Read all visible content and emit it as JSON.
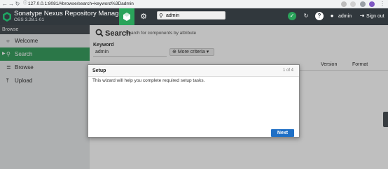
{
  "browser": {
    "url": "127.0.0.1:8081/#browse/search=keyword%3Dadmin"
  },
  "header": {
    "title": "Sonatype Nexus Repository Manager",
    "version": "OSS 3.28.1-01",
    "search_value": "admin",
    "user": "admin",
    "signout": "Sign out"
  },
  "sidebar": {
    "heading": "Browse",
    "items": [
      {
        "label": "Welcome",
        "icon": "circle-icon"
      },
      {
        "label": "Search",
        "icon": "search-icon"
      },
      {
        "label": "Browse",
        "icon": "database-icon"
      },
      {
        "label": "Upload",
        "icon": "upload-icon"
      }
    ]
  },
  "main": {
    "title": "Search",
    "subtitle": "Search for components by attribute",
    "keyword_label": "Keyword",
    "keyword_value": "admin",
    "more_criteria": "More criteria",
    "columns": [
      "Version",
      "Format"
    ]
  },
  "modal": {
    "title": "Setup",
    "step": "1 of 4",
    "body": "This wizard will help you complete required setup tasks.",
    "next": "Next"
  },
  "colors": {
    "header": "#31383d",
    "accent": "#3a9f61",
    "primary_button": "#1f6fc5"
  }
}
